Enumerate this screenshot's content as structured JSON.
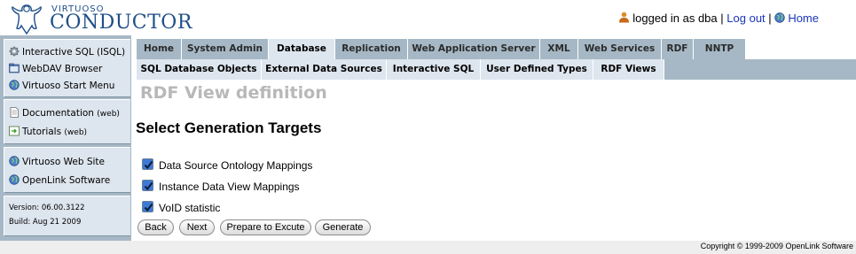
{
  "brand": {
    "small": "VIRTUOSO",
    "big": "CONDUCTOR"
  },
  "user": {
    "logged_text": "logged in as dba",
    "sep1": "|",
    "logout": "Log out",
    "sep2": "|",
    "home": "Home"
  },
  "sidebar": {
    "group1": [
      {
        "label": "Interactive SQL (ISQL)",
        "icon": "gear-icon"
      },
      {
        "label": "WebDAV Browser",
        "icon": "folder-icon"
      },
      {
        "label": "Virtuoso Start Menu",
        "icon": "globe-icon"
      }
    ],
    "group2": [
      {
        "label": "Documentation",
        "suffix": "(web)",
        "icon": "document-icon"
      },
      {
        "label": "Tutorials",
        "suffix": "(web)",
        "icon": "tutorial-icon"
      }
    ],
    "group3": [
      {
        "label": "Virtuoso Web Site",
        "icon": "globe-icon"
      },
      {
        "label": "OpenLink Software",
        "icon": "globe-icon"
      }
    ],
    "version": "Version: 06.00.3122",
    "build": "Build: Aug 21 2009"
  },
  "tabs_main": [
    "Home",
    "System Admin",
    "Database",
    "Replication",
    "Web Application Server",
    "XML",
    "Web Services",
    "RDF",
    "NNTP"
  ],
  "tabs_main_active": "Database",
  "tabs_sub": [
    "SQL Database Objects",
    "External Data Sources",
    "Interactive SQL",
    "User Defined Types",
    "RDF Views"
  ],
  "content": {
    "page_title": "RDF View definition",
    "section_heading": "Select Generation Targets",
    "checkboxes": [
      {
        "label": "Data Source Ontology Mappings",
        "checked": true
      },
      {
        "label": "Instance Data View Mappings",
        "checked": true
      },
      {
        "label": "VoID statistic",
        "checked": true
      }
    ],
    "buttons": {
      "back": "Back",
      "next": "Next",
      "prepare": "Prepare to Excute",
      "generate": "Generate"
    }
  },
  "footer": {
    "copyright": "Copyright © 1999-2009 OpenLink Software"
  },
  "colors": {
    "nav_bg": "#a6b8c5",
    "panel_bg": "#dde5ee",
    "link": "#1a36b8",
    "brand": "#1f4f8a",
    "title_gray": "#b8b8b8"
  }
}
